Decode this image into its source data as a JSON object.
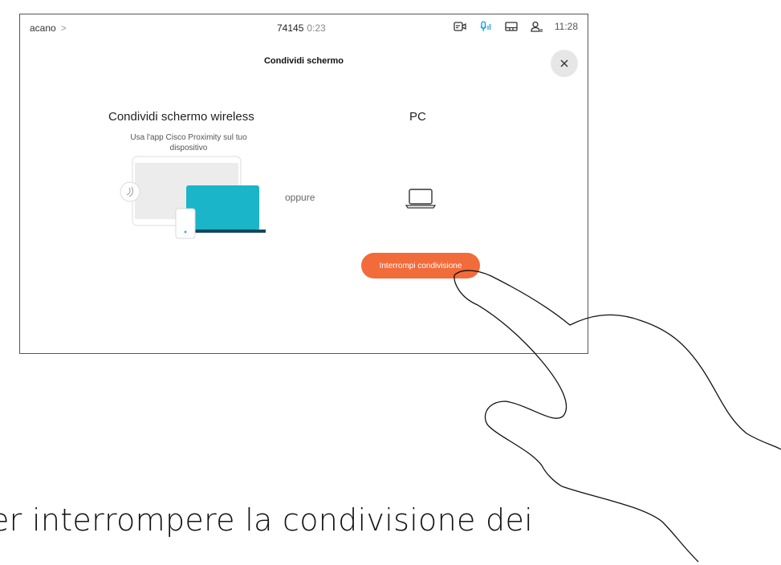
{
  "statusbar": {
    "breadcrumb": "acano",
    "breadcrumb_chevron": ">",
    "call_number": "74145",
    "call_duration": "0:23",
    "clock": "11:28",
    "icons": [
      "camera-icon",
      "microphone-icon",
      "display-icon",
      "participants-icon"
    ],
    "mic_color": "#00a0d1"
  },
  "dialog": {
    "title": "Condividi schermo",
    "close_icon": "close-icon",
    "wireless": {
      "title": "Condividi schermo wireless",
      "description": "Usa l'app Cisco Proximity sul tuo dispositivo"
    },
    "separator": "oppure",
    "pc": {
      "title": "PC",
      "icon": "laptop-icon"
    },
    "stop_button": "Interrompi condivisione",
    "accent_color": "#f26b3a",
    "illustration_color": "#1ab5c8"
  },
  "caption": "er interrompere la condivisione dei"
}
